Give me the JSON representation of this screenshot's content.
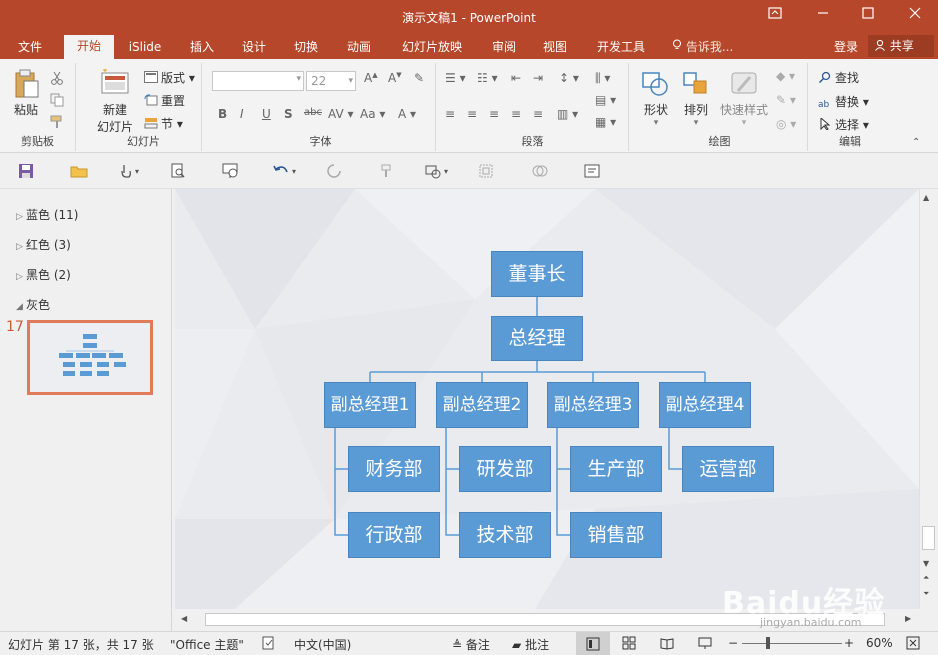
{
  "window": {
    "title": "演示文稿1 - PowerPoint"
  },
  "tabs": [
    "文件",
    "开始",
    "iSlide",
    "插入",
    "设计",
    "切换",
    "动画",
    "幻灯片放映",
    "审阅",
    "视图",
    "开发工具"
  ],
  "tell_me": "告诉我...",
  "login": "登录",
  "share": "共享",
  "ribbon": {
    "clipboard": {
      "paste": "粘贴",
      "label": "剪贴板"
    },
    "slides": {
      "new_slide_line1": "新建",
      "new_slide_line2": "幻灯片",
      "layout": "版式",
      "reset": "重置",
      "section": "节",
      "label": "幻灯片"
    },
    "font": {
      "font_name": "",
      "font_size": "22",
      "label": "字体"
    },
    "paragraph": {
      "label": "段落"
    },
    "drawing": {
      "shapes": "形状",
      "arrange": "排列",
      "quick_styles": "快速样式",
      "label": "绘图"
    },
    "editing": {
      "find": "查找",
      "replace": "替换",
      "select": "选择",
      "label": "编辑"
    }
  },
  "sections": [
    {
      "name": "蓝色 (11)",
      "expanded": false
    },
    {
      "name": "红色 (3)",
      "expanded": false
    },
    {
      "name": "黑色 (2)",
      "expanded": false
    },
    {
      "name": "灰色",
      "expanded": true
    }
  ],
  "current_slide_number": "17",
  "org_chart": {
    "chairman": "董事长",
    "gm": "总经理",
    "vps": [
      "副总经理1",
      "副总经理2",
      "副总经理3",
      "副总经理4"
    ],
    "departments": [
      "财务部",
      "行政部",
      "研发部",
      "技术部",
      "生产部",
      "销售部",
      "运营部"
    ]
  },
  "status": {
    "slide_info": "幻灯片 第 17 张，共 17 张",
    "theme": "\"Office 主题\"",
    "language": "中文(中国)",
    "notes": "备注",
    "comments": "批注",
    "zoom": "60%"
  },
  "watermark": {
    "brand": "Baidu经验",
    "url": "jingyan.baidu.com"
  },
  "colors": {
    "accent": "#b7472a",
    "box_fill": "#5b9bd5",
    "thumb_border": "#e07b5a"
  }
}
